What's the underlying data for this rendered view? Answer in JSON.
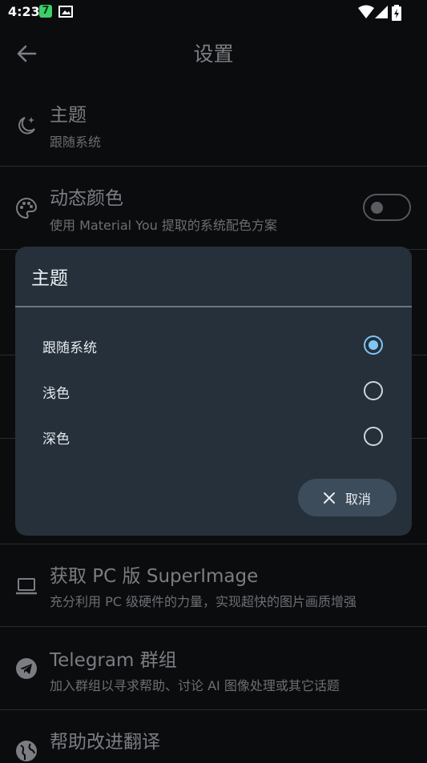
{
  "status_bar": {
    "time": "4:23",
    "notif_badge": "7"
  },
  "app_bar": {
    "title": "设置"
  },
  "settings": [
    {
      "title": "主题",
      "subtitle": "跟随系统"
    },
    {
      "title": "动态颜色",
      "subtitle": "使用 Material You 提取的系统配色方案",
      "toggle_on": false
    },
    {
      "title": "获取 PC 版 SuperImage",
      "subtitle": "充分利用 PC 级硬件的力量，实现超快的图片画质增强"
    },
    {
      "title": "Telegram 群组",
      "subtitle": "加入群组以寻求帮助、讨论 AI 图像处理或其它话题"
    },
    {
      "title": "帮助改进翻译"
    }
  ],
  "dialog": {
    "title": "主题",
    "options": [
      {
        "label": "跟随系统",
        "selected": true
      },
      {
        "label": "浅色",
        "selected": false
      },
      {
        "label": "深色",
        "selected": false
      }
    ],
    "cancel_label": "取消"
  },
  "colors": {
    "accent": "#7fc6f5",
    "dialog_bg": "#25303a",
    "background": "#0b0c0e"
  }
}
